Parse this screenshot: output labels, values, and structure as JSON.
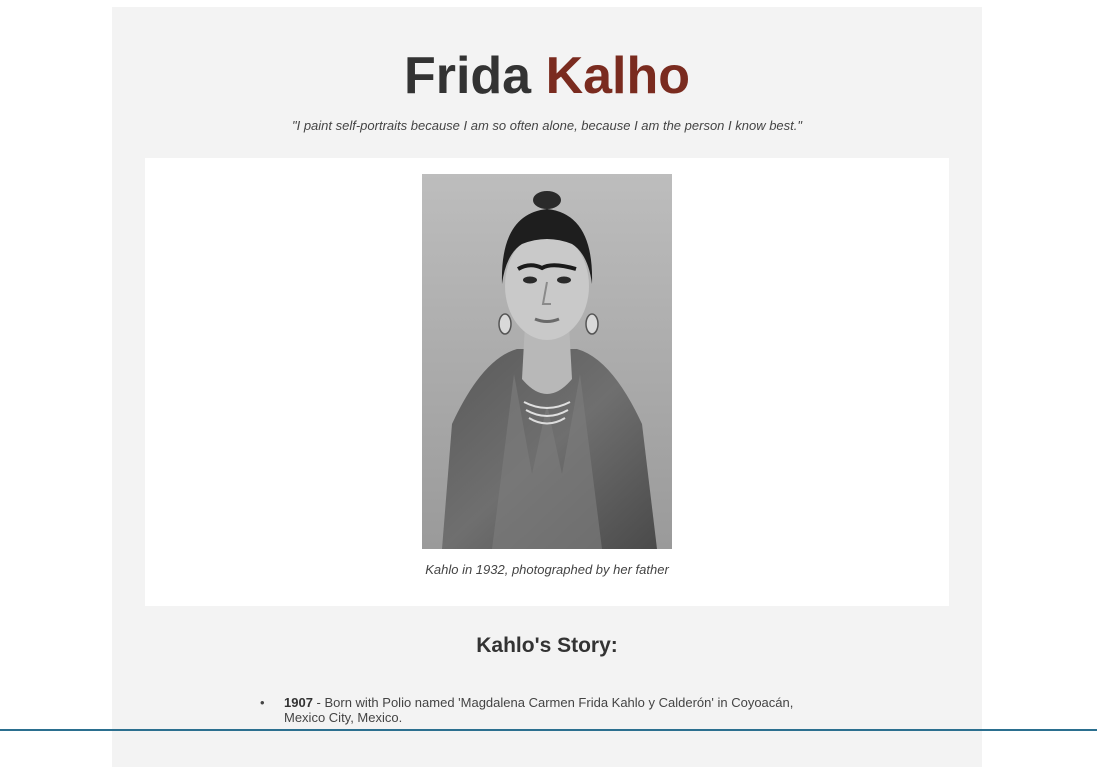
{
  "header": {
    "title_first": "Frida",
    "title_last": "Kalho",
    "tagline": "\"I paint self-portraits because I am so often alone, because I am the person I know best.\""
  },
  "figure": {
    "caption": "Kahlo in 1932, photographed by her father"
  },
  "story": {
    "heading": "Kahlo's Story:",
    "items": [
      {
        "year": "1907",
        "text": " - Born with Polio named 'Magdalena Carmen Frida Kahlo y Calderón' in Coyoacán, Mexico City, Mexico."
      }
    ]
  },
  "colors": {
    "background": "#f3f3f3",
    "accent": "#7a2b1f",
    "text": "#333333"
  }
}
